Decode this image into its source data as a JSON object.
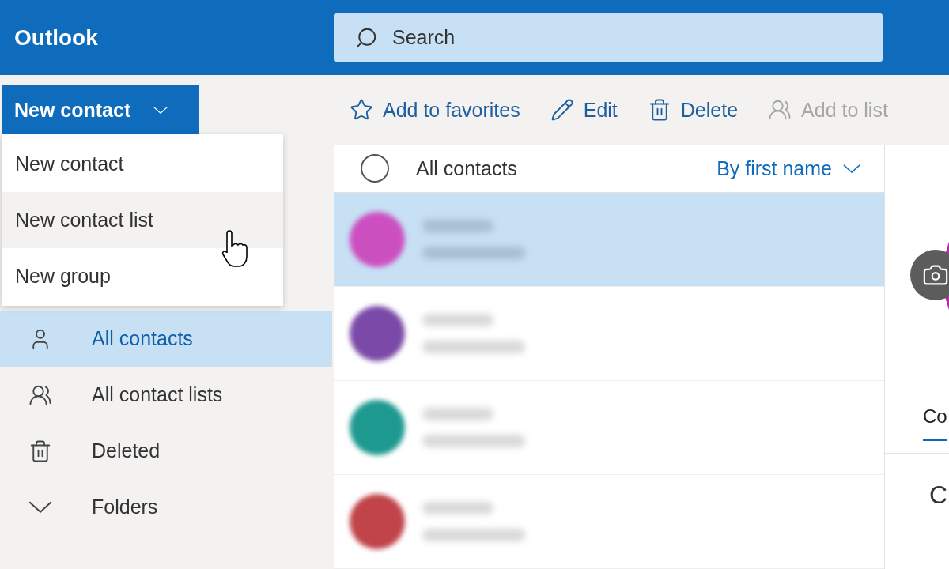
{
  "app": {
    "title": "Outlook"
  },
  "search": {
    "placeholder": "Search"
  },
  "new_button": {
    "label": "New contact",
    "expanded": true
  },
  "toolbar": [
    {
      "label": "Add to favorites",
      "kind": "star",
      "disabled": false
    },
    {
      "label": "Edit",
      "kind": "pencil",
      "disabled": false
    },
    {
      "label": "Delete",
      "kind": "trash",
      "disabled": false
    },
    {
      "label": "Add to list",
      "kind": "people",
      "disabled": true
    }
  ],
  "menu": [
    {
      "label": "New contact",
      "hovered": false
    },
    {
      "label": "New contact list",
      "hovered": true
    },
    {
      "label": "New group",
      "hovered": false
    }
  ],
  "sidebar": {
    "items": [
      {
        "label": "All contacts",
        "kind": "person",
        "selected": true
      },
      {
        "label": "All contact lists",
        "kind": "people",
        "selected": false
      },
      {
        "label": "Deleted",
        "kind": "trash",
        "selected": false
      },
      {
        "label": "Folders",
        "kind": "chevron",
        "selected": false
      }
    ]
  },
  "list": {
    "checked": false,
    "title": "All contacts",
    "sort": "By first name",
    "contacts": [
      {
        "color": "#cc4fc0",
        "selected": true
      },
      {
        "color": "#7b4aa8",
        "selected": false
      },
      {
        "color": "#1e9990",
        "selected": false
      },
      {
        "color": "#c0444a",
        "selected": false
      }
    ]
  },
  "details": {
    "tab": "Co",
    "section": "C"
  }
}
